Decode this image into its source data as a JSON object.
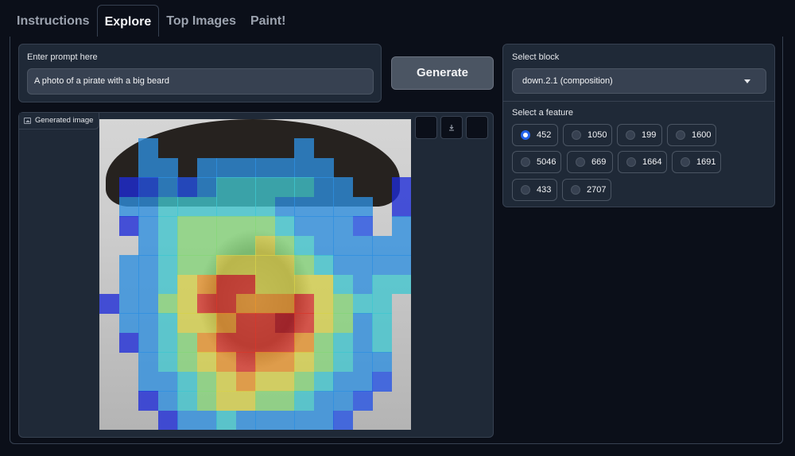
{
  "tabs": [
    {
      "label": "Instructions",
      "active": false
    },
    {
      "label": "Explore",
      "active": true
    },
    {
      "label": "Top Images",
      "active": false
    },
    {
      "label": "Paint!",
      "active": false
    }
  ],
  "prompt": {
    "label": "Enter prompt here",
    "value": "A photo of a pirate with a big beard"
  },
  "generate_label": "Generate",
  "image": {
    "label": "Generated image",
    "download_icon": "download-icon"
  },
  "block": {
    "label": "Select block",
    "selected": "down.2.1 (composition)"
  },
  "feature": {
    "label": "Select a feature",
    "options": [
      "452",
      "1050",
      "199",
      "1600",
      "5046",
      "669",
      "1664",
      "1691",
      "433",
      "2707"
    ],
    "selected": "452"
  },
  "colors": {
    "accent": "#2563eb",
    "background": "#0b0f19",
    "panel": "#1f2937"
  },
  "heatmap": {
    "rows": 16,
    "cols": 16,
    "values": [
      [
        0,
        0,
        0,
        0,
        0,
        0,
        0,
        0,
        0,
        0,
        0,
        0,
        0,
        0,
        0,
        0
      ],
      [
        0,
        0,
        3,
        0,
        0,
        0,
        0,
        0,
        0,
        0,
        3,
        0,
        0,
        0,
        0,
        0
      ],
      [
        0,
        0,
        3,
        3,
        0,
        3,
        3,
        3,
        3,
        3,
        3,
        3,
        0,
        0,
        0,
        0
      ],
      [
        0,
        1,
        2,
        3,
        2,
        3,
        4,
        4,
        4,
        4,
        4,
        3,
        3,
        0,
        0,
        1
      ],
      [
        0,
        3,
        3,
        4,
        4,
        4,
        4,
        4,
        4,
        3,
        3,
        3,
        3,
        3,
        0,
        1
      ],
      [
        0,
        1,
        3,
        4,
        5,
        5,
        5,
        5,
        5,
        4,
        3,
        3,
        3,
        2,
        0,
        3
      ],
      [
        0,
        0,
        3,
        4,
        5,
        5,
        5,
        5,
        6,
        5,
        4,
        3,
        3,
        3,
        3,
        3
      ],
      [
        0,
        3,
        3,
        4,
        5,
        5,
        6,
        6,
        6,
        6,
        5,
        4,
        3,
        3,
        3,
        3
      ],
      [
        0,
        3,
        3,
        4,
        6,
        7,
        8,
        8,
        6,
        6,
        6,
        6,
        4,
        3,
        4,
        4
      ],
      [
        1,
        3,
        3,
        5,
        6,
        8,
        8,
        7,
        7,
        7,
        8,
        6,
        5,
        4,
        4,
        0
      ],
      [
        0,
        3,
        3,
        4,
        6,
        6,
        7,
        8,
        8,
        9,
        8,
        6,
        5,
        3,
        4,
        0
      ],
      [
        0,
        1,
        3,
        4,
        5,
        7,
        8,
        8,
        8,
        8,
        7,
        5,
        4,
        3,
        4,
        0
      ],
      [
        0,
        0,
        3,
        4,
        5,
        6,
        7,
        8,
        7,
        7,
        6,
        5,
        4,
        3,
        3,
        0
      ],
      [
        0,
        0,
        3,
        3,
        4,
        5,
        6,
        7,
        6,
        6,
        5,
        4,
        3,
        3,
        2,
        0
      ],
      [
        0,
        0,
        1,
        3,
        4,
        5,
        6,
        6,
        5,
        5,
        4,
        3,
        3,
        2,
        0,
        0
      ],
      [
        0,
        0,
        0,
        1,
        3,
        3,
        4,
        3,
        3,
        3,
        3,
        3,
        2,
        0,
        0,
        0
      ]
    ]
  }
}
